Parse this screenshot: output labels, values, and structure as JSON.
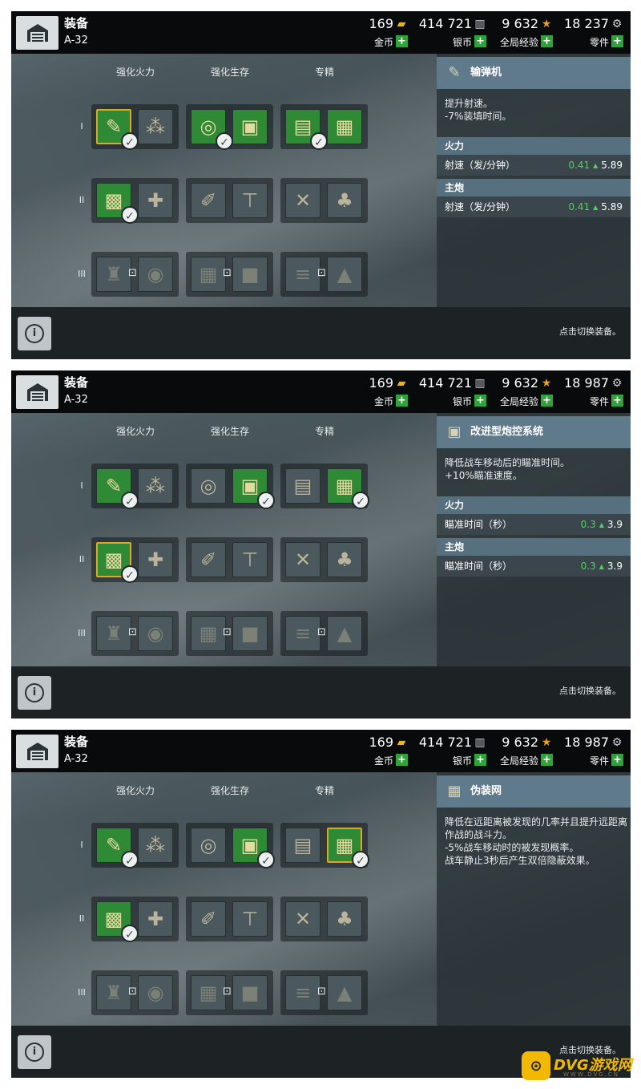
{
  "panels": [
    {
      "title": "装备",
      "tank": "A-32",
      "resources": [
        {
          "value": "169",
          "label": "金币",
          "icon": "coin-icon"
        },
        {
          "value": "414 721",
          "label": "银币",
          "icon": "silver-icon"
        },
        {
          "value": "9 632",
          "label": "全局经验",
          "icon": "star-icon"
        },
        {
          "value": "18 237",
          "label": "零件",
          "icon": "gear-icon"
        }
      ],
      "columns": [
        "强化火力",
        "强化生存",
        "专精"
      ],
      "tiers": [
        "I",
        "II",
        "III"
      ],
      "hint": "点击切换装备。",
      "info": {
        "name": "输弹机",
        "icon": "rammer-icon",
        "description": "提升射速。\n-7%装填时间。",
        "sections": [
          {
            "label": "火力",
            "stat": "射速（发/分钟）",
            "delta": "0.41",
            "value": "5.89"
          },
          {
            "label": "主炮",
            "stat": "射速（发/分钟）",
            "delta": "0.41",
            "value": "5.89"
          }
        ]
      }
    },
    {
      "title": "装备",
      "tank": "A-32",
      "resources": [
        {
          "value": "169",
          "label": "金币",
          "icon": "coin-icon"
        },
        {
          "value": "414 721",
          "label": "银币",
          "icon": "silver-icon"
        },
        {
          "value": "9 632",
          "label": "全局经验",
          "icon": "star-icon"
        },
        {
          "value": "18 987",
          "label": "零件",
          "icon": "gear-icon"
        }
      ],
      "columns": [
        "强化火力",
        "强化生存",
        "专精"
      ],
      "tiers": [
        "I",
        "II",
        "III"
      ],
      "hint": "点击切换装备。",
      "info": {
        "name": "改进型炮控系统",
        "icon": "gun-control-icon",
        "description": "降低战车移动后的瞄准时间。\n+10%瞄准速度。",
        "sections": [
          {
            "label": "火力",
            "stat": "瞄准时间（秒）",
            "delta": "0.3",
            "value": "3.9"
          },
          {
            "label": "主炮",
            "stat": "瞄准时间（秒）",
            "delta": "0.3",
            "value": "3.9"
          }
        ]
      }
    },
    {
      "title": "装备",
      "tank": "A-32",
      "resources": [
        {
          "value": "169",
          "label": "金币",
          "icon": "coin-icon"
        },
        {
          "value": "414 721",
          "label": "银币",
          "icon": "silver-icon"
        },
        {
          "value": "9 632",
          "label": "全局经验",
          "icon": "star-icon"
        },
        {
          "value": "18 987",
          "label": "零件",
          "icon": "gear-icon"
        }
      ],
      "columns": [
        "强化火力",
        "强化生存",
        "专精"
      ],
      "tiers": [
        "I",
        "II",
        "III"
      ],
      "hint": "点击切换装备。",
      "info": {
        "name": "伪装网",
        "icon": "camo-net-icon",
        "description": "降低在远距离被发现的几率并且提升远距离作战的战斗力。\n-5%战车移动时的被发现概率。\n战车静止3秒后产生双倍隐蔽效果。",
        "sections": []
      }
    }
  ],
  "watermark": {
    "text": "DVG游戏网",
    "small": "WWW.DVG.CN",
    "logo": "gamepad-logo"
  }
}
